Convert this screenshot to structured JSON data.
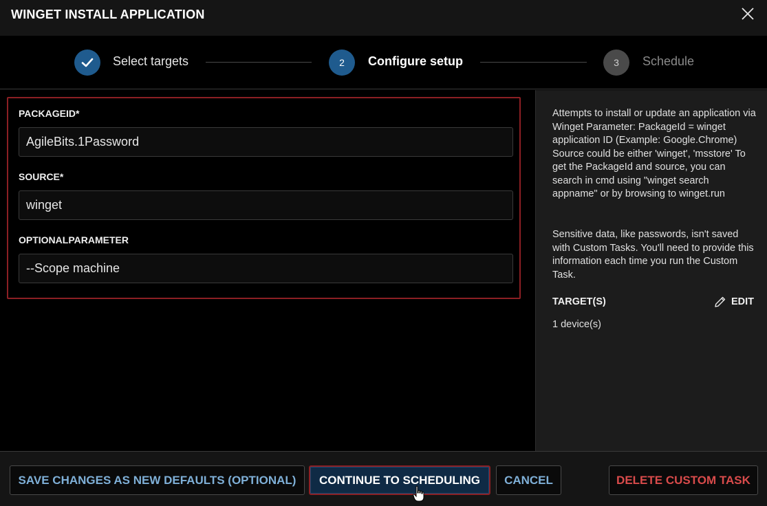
{
  "dialog": {
    "title": "WINGET INSTALL APPLICATION"
  },
  "stepper": {
    "steps": [
      {
        "number": "",
        "label": "Select targets",
        "state": "completed"
      },
      {
        "number": "2",
        "label": "Configure setup",
        "state": "active"
      },
      {
        "number": "3",
        "label": "Schedule",
        "state": "pending"
      }
    ]
  },
  "form": {
    "fields": [
      {
        "label": "PACKAGEID*",
        "value": "AgileBits.1Password"
      },
      {
        "label": "SOURCE*",
        "value": "winget"
      },
      {
        "label": "OPTIONALPARAMETER",
        "value": "--Scope machine"
      }
    ]
  },
  "info": {
    "description": "Attempts to install or update an application via Winget Parameter: PackageId = winget application ID (Example: Google.Chrome) Source could be either 'winget', 'msstore' To get the PackageId and source, you can search in cmd using \"winget search appname\" or by browsing to winget.run",
    "sensitive_note": "Sensitive data, like passwords, isn't saved with Custom Tasks. You'll need to provide this information each time you run the Custom Task.",
    "targets_heading": "TARGET(S)",
    "edit_label": "EDIT",
    "device_count": "1 device(s)"
  },
  "footer": {
    "save_defaults_label": "SAVE CHANGES AS NEW DEFAULTS (OPTIONAL)",
    "continue_label": "CONTINUE TO SCHEDULING",
    "cancel_label": "CANCEL",
    "delete_label": "DELETE CUSTOM TASK"
  },
  "colors": {
    "accent": "#1f5b8e",
    "highlight_border": "#8c1f24",
    "link_blue": "#7fb0d8",
    "danger": "#d94b4b"
  }
}
